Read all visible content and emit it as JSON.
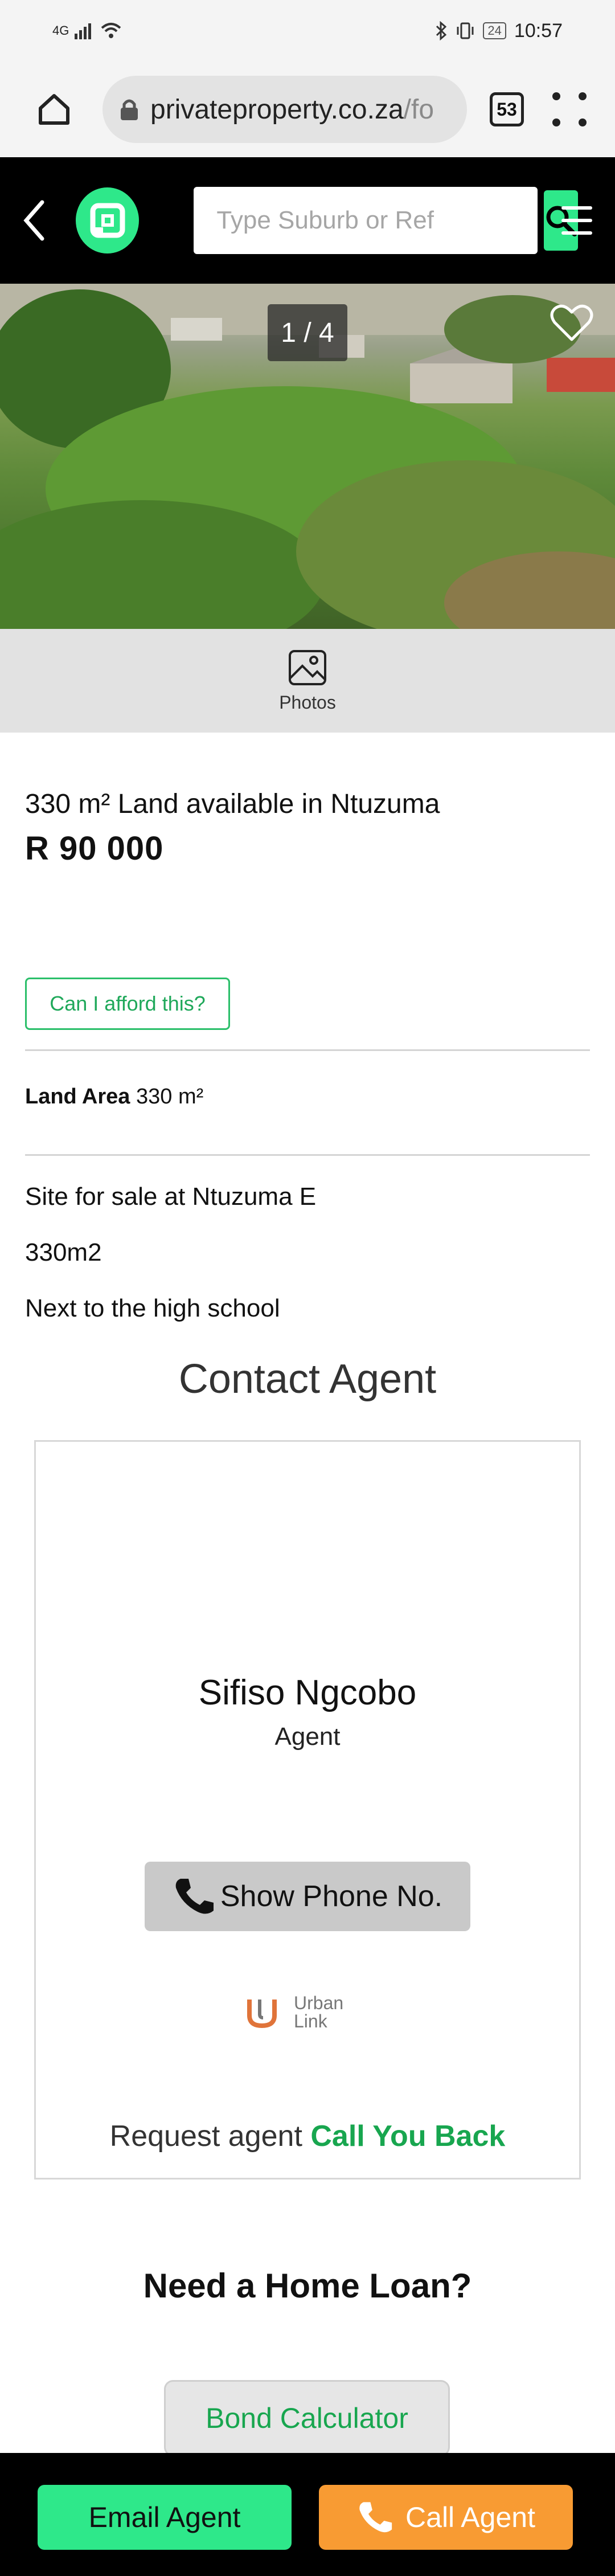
{
  "status_bar": {
    "network": "4G",
    "battery": "24",
    "time": "10:57"
  },
  "browser": {
    "url_main": "privateproperty.co.za",
    "url_rest": "/fo",
    "tab_count": "53"
  },
  "header": {
    "search_placeholder": "Type Suburb or Ref"
  },
  "gallery": {
    "counter": "1 / 4",
    "photos_label": "Photos"
  },
  "listing": {
    "title": "330 m² Land available in Ntuzuma",
    "price": "R 90 000",
    "afford_label": "Can I afford this?",
    "land_area_label": "Land Area",
    "land_area_value": "330 m²",
    "description": [
      "Site for sale at Ntuzuma E",
      "330m2",
      "Next to the high school"
    ]
  },
  "contact": {
    "heading": "Contact Agent",
    "agent_name": "Sifiso Ngcobo",
    "agent_role": "Agent",
    "phone_button": "Show Phone No.",
    "agency_line1": "Urban",
    "agency_line2": "Link",
    "callback_prefix": "Request agent",
    "callback_link": "Call You Back"
  },
  "loan": {
    "heading": "Need a Home Loan?",
    "bond_button": "Bond Calculator"
  },
  "bottom_bar": {
    "email_button": "Email Agent",
    "call_button": "Call Agent"
  },
  "colors": {
    "brand_green": "#2ee88a",
    "link_green": "#18a64f",
    "call_orange": "#f89b33"
  }
}
